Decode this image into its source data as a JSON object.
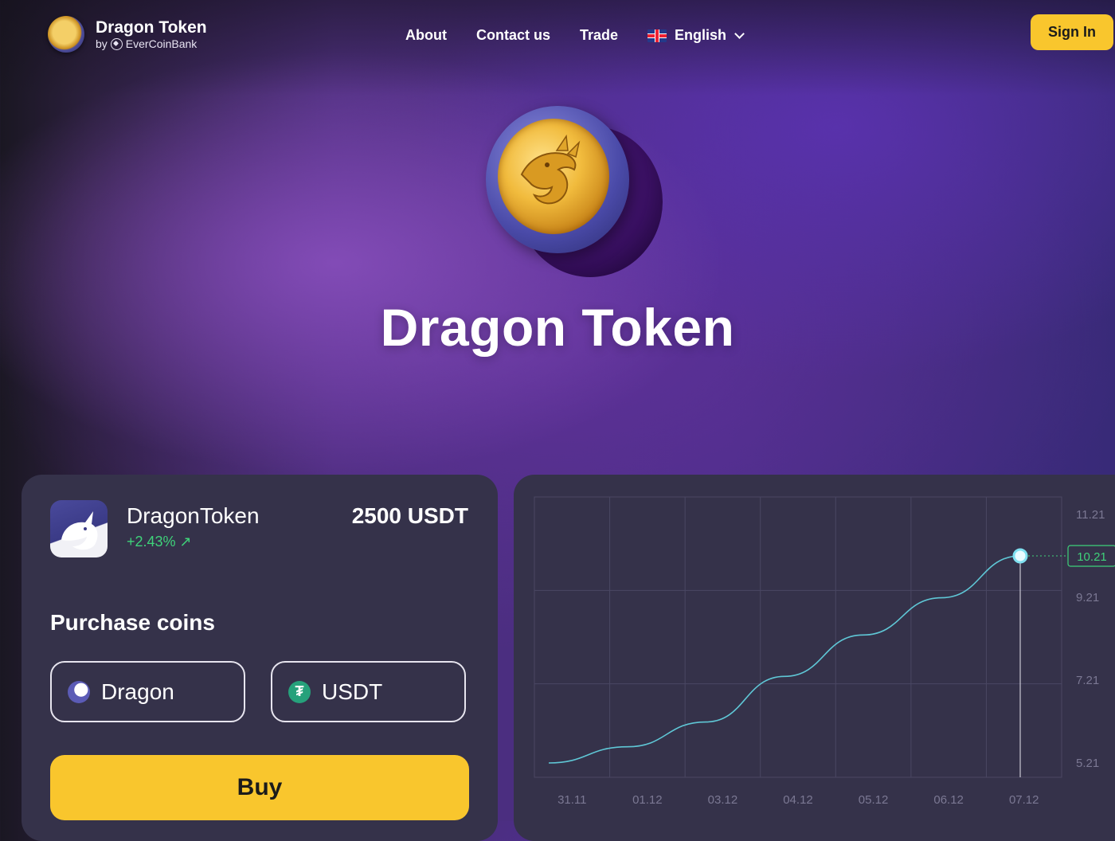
{
  "brand": {
    "title": "Dragon Token",
    "by": "by",
    "company": "EverCoinBank"
  },
  "nav": {
    "about": "About",
    "contact": "Contact us",
    "trade": "Trade",
    "language": "English"
  },
  "header": {
    "signin": "Sign In"
  },
  "hero": {
    "title": "Dragon Token"
  },
  "token": {
    "name": "DragonToken",
    "change": "+2.43% ↗",
    "price": "2500 USDT"
  },
  "purchase": {
    "title": "Purchase coins",
    "from": "Dragon",
    "to": "USDT",
    "buy": "Buy"
  },
  "icons": {
    "brand": "dragon-coin-icon",
    "language": "uk-flag-icon",
    "token": "dragon-icon",
    "from": "dragon-icon",
    "to": "tether-icon"
  },
  "colors": {
    "accent": "#f9c62d",
    "positive": "#3fd27a",
    "panel": "#35324a",
    "line": "#5fc7d6"
  },
  "chart_data": {
    "type": "line",
    "x": [
      "31.11",
      "01.12",
      "03.12",
      "04.12",
      "05.12",
      "06.12",
      "07.12"
    ],
    "series": [
      {
        "values": [
          5.21,
          5.6,
          6.2,
          7.3,
          8.3,
          9.2,
          10.21
        ]
      }
    ],
    "y_ticks": [
      11.21,
      9.21,
      7.21,
      5.21
    ],
    "current_value": "10.21",
    "ylim": [
      5.21,
      11.21
    ],
    "grid": true
  }
}
